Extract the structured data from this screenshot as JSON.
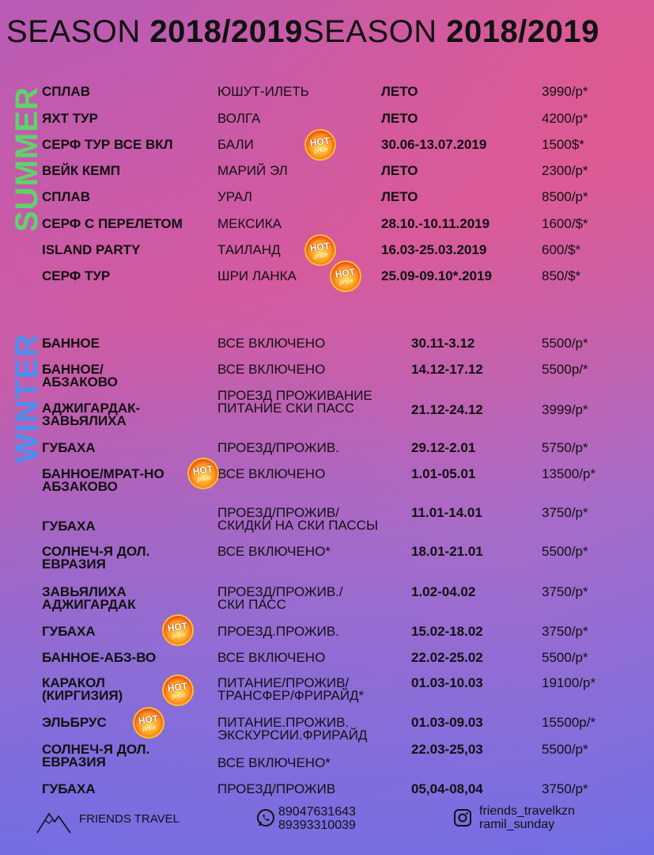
{
  "header": {
    "title_light_1": "SEASON ",
    "title_bold_1": "2018/2019",
    "title_light_2": "SEASON ",
    "title_bold_2": "2018/2019"
  },
  "sections": {
    "summer_label": "SUMMER",
    "winter_label": "WINTER"
  },
  "hot_badge": {
    "line1": "HOT",
    "line2": "price"
  },
  "summer": [
    {
      "name": [
        "СПЛАВ"
      ],
      "place": [
        "ЮШУТ-ИЛЕТЬ"
      ],
      "date": "ЛЕТО",
      "price": "3990/р*"
    },
    {
      "name": [
        "ЯХТ ТУР"
      ],
      "place": [
        "ВОЛГА"
      ],
      "date": "ЛЕТО",
      "price": "4200/р*"
    },
    {
      "name": [
        "СЕРФ ТУР ВСЕ ВКЛ"
      ],
      "place": [
        "БАЛИ"
      ],
      "date": "30.06-13.07.2019",
      "price": "1500$*"
    },
    {
      "name": [
        "ВЕЙК КЕМП"
      ],
      "place": [
        "МАРИЙ ЭЛ"
      ],
      "date": "ЛЕТО",
      "price": "2300/р*"
    },
    {
      "name": [
        "СПЛАВ"
      ],
      "place": [
        "УРАЛ"
      ],
      "date": "ЛЕТО",
      "price": "8500/р*"
    },
    {
      "name": [
        "СЕРФ С ПЕРЕЛЕТОМ"
      ],
      "place": [
        "МЕКСИКА"
      ],
      "date": "28.10.-10.11.2019",
      "price": "1600/$*"
    },
    {
      "name": [
        "ISLAND PARTY"
      ],
      "place": [
        "ТАИЛАНД"
      ],
      "date": "16.03-25.03.2019",
      "price": "600/$*"
    },
    {
      "name": [
        "СЕРФ ТУР"
      ],
      "place": [
        "ШРИ ЛАНКА"
      ],
      "date": "25.09-09.10*.2019",
      "price": "850/$*"
    }
  ],
  "winter": [
    {
      "name": [
        "БАННОЕ"
      ],
      "place": [
        "ВСЕ ВКЛЮЧЕНО"
      ],
      "date": "30.11-3.12",
      "price": "5500/р*"
    },
    {
      "name": [
        "БАННОЕ/",
        "АБЗАКОВО"
      ],
      "place": [
        "ВСЕ ВКЛЮЧЕНО"
      ],
      "date": "14.12-17.12",
      "price": "5500р/*"
    },
    {
      "name": [
        "АДЖИГАРДАК-",
        "ЗАВЬЯЛИХА"
      ],
      "place": [
        "ПРОЕЗД ПРОЖИВАНИЕ",
        "ПИТАНИЕ СКИ ПАСС"
      ],
      "date": "21.12-24.12",
      "price": "3999/р*"
    },
    {
      "name": [
        "ГУБАХА"
      ],
      "place": [
        "ПРОЕЗД/ПРОЖИВ."
      ],
      "date": "29.12-2.01",
      "price": "5750/р*"
    },
    {
      "name": [
        "БАННОЕ/МРАТ-НО",
        "АБЗАКОВО"
      ],
      "place": [
        "ВСЕ ВКЛЮЧЕНО"
      ],
      "date": "1.01-05.01",
      "price": "13500/р*"
    },
    {
      "name": [
        "ГУБАХА"
      ],
      "place": [
        "ПРОЕЗД/ПРОЖИВ/",
        "СКИДКИ НА СКИ ПАССЫ"
      ],
      "date": "11.01-14.01",
      "price": "3750/р*"
    },
    {
      "name": [
        "СОЛНЕЧ-Я ДОЛ.",
        "ЕВРАЗИЯ"
      ],
      "place": [
        "ВСЕ ВКЛЮЧЕНО*"
      ],
      "date": "18.01-21.01",
      "price": "5500/р*"
    },
    {
      "name": [
        "ЗАВЬЯЛИХА",
        "АДЖИГАРДАК"
      ],
      "place": [
        "ПРОЕЗД/ПРОЖИВ./",
        "СКИ ПАСС"
      ],
      "date": "1.02-04.02",
      "price": "3750/р*"
    },
    {
      "name": [
        "ГУБАХА"
      ],
      "place": [
        "ПРОЕЗД.ПРОЖИВ."
      ],
      "date": "15.02-18.02",
      "price": "3750/р*"
    },
    {
      "name": [
        "БАННОЕ-АБЗ-ВО"
      ],
      "place": [
        "ВСЕ ВКЛЮЧЕНО"
      ],
      "date": "22.02-25.02",
      "price": "5500/р*"
    },
    {
      "name": [
        "КАРАКОЛ",
        "(КИРГИЗИЯ)"
      ],
      "place": [
        "ПИТАНИЕ/ПРОЖИВ/",
        "ТРАНСФЕР/ФРИРАЙД*"
      ],
      "date": "01.03-10.03",
      "price": "19100/р*"
    },
    {
      "name": [
        "ЭЛЬБРУС"
      ],
      "place": [
        "ПИТАНИЕ.ПРОЖИВ.",
        "ЭКСКУРСИИ.ФРИРАЙД"
      ],
      "date": "01.03-09.03",
      "price": "15500р/*"
    },
    {
      "name": [
        "СОЛНЕЧ-Я ДОЛ.",
        "ЕВРАЗИЯ"
      ],
      "place": [
        "ВСЕ ВКЛЮЧЕНО*"
      ],
      "date": "22.03-25,03",
      "price": "5500/р*"
    },
    {
      "name": [
        "ГУБАХА"
      ],
      "place": [
        "ПРОЕЗД/ПРОЖИВ"
      ],
      "date": "05,04-08,04",
      "price": "3750/р*"
    }
  ],
  "footer": {
    "brand": "FRIENDS TRAVEL",
    "phones": [
      "89047631643",
      "89393310039"
    ],
    "socials": [
      "friends_travelkzn",
      "ramil_sunday"
    ],
    "logo_icon": "mountain-logo-icon",
    "phone_icon": "whatsapp-icon",
    "social_icon": "instagram-icon"
  }
}
